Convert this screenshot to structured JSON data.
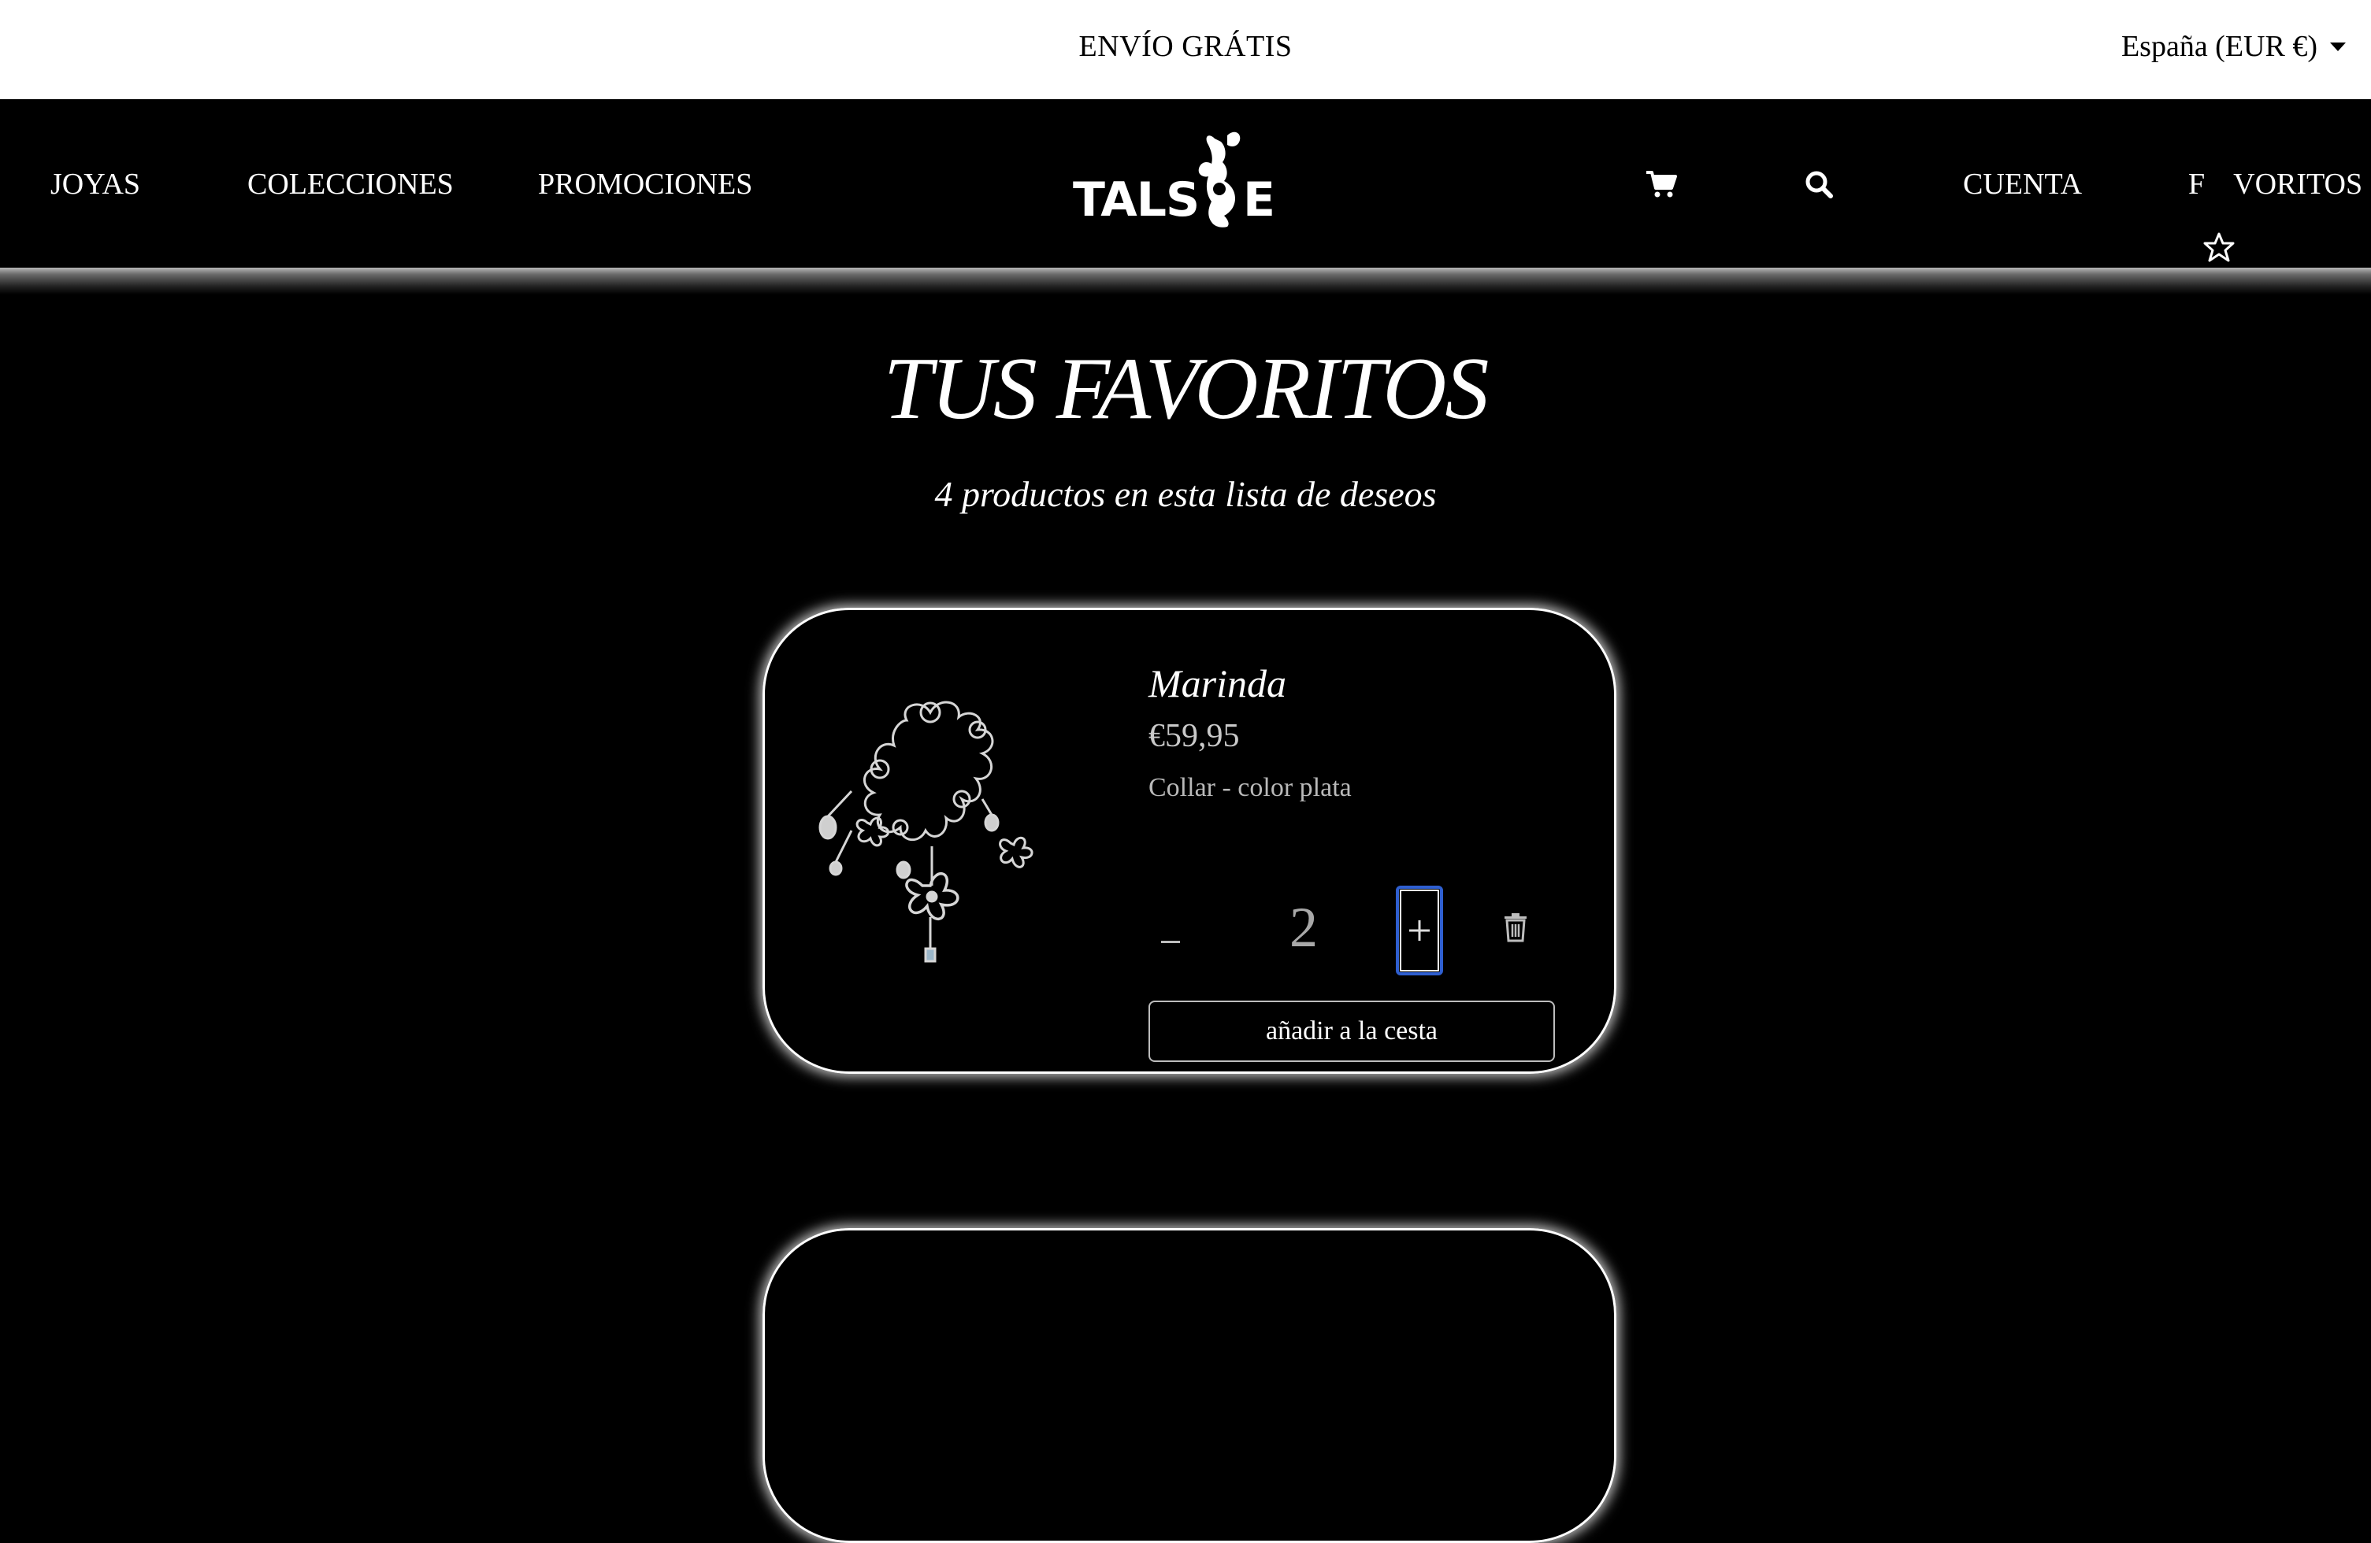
{
  "announcement": {
    "text": "ENVÍO GRÁTIS"
  },
  "locale": {
    "label": "España (EUR €)"
  },
  "nav": {
    "links": {
      "jewelry": "JOYAS",
      "collections": "COLECCIONES",
      "promotions": "PROMOCIONES"
    },
    "logo_text": "TALSIE",
    "account": "CUENTA",
    "favorites_prefix": "F",
    "favorites_suffix": "VORITOS",
    "icons": [
      "cart-icon",
      "search-icon",
      "star-icon"
    ]
  },
  "page": {
    "title": "TUS FAVORITOS",
    "subtitle": "4 productos en esta lista de deseos"
  },
  "wishlist": {
    "items": [
      {
        "name": "Marinda",
        "price": "€59,95",
        "variant": "Collar - color plata",
        "quantity": "2",
        "add_to_cart": "añadir a la cesta"
      }
    ]
  },
  "colors": {
    "background": "#000000",
    "text": "#ffffff",
    "focus_ring": "#2f5fd0"
  }
}
